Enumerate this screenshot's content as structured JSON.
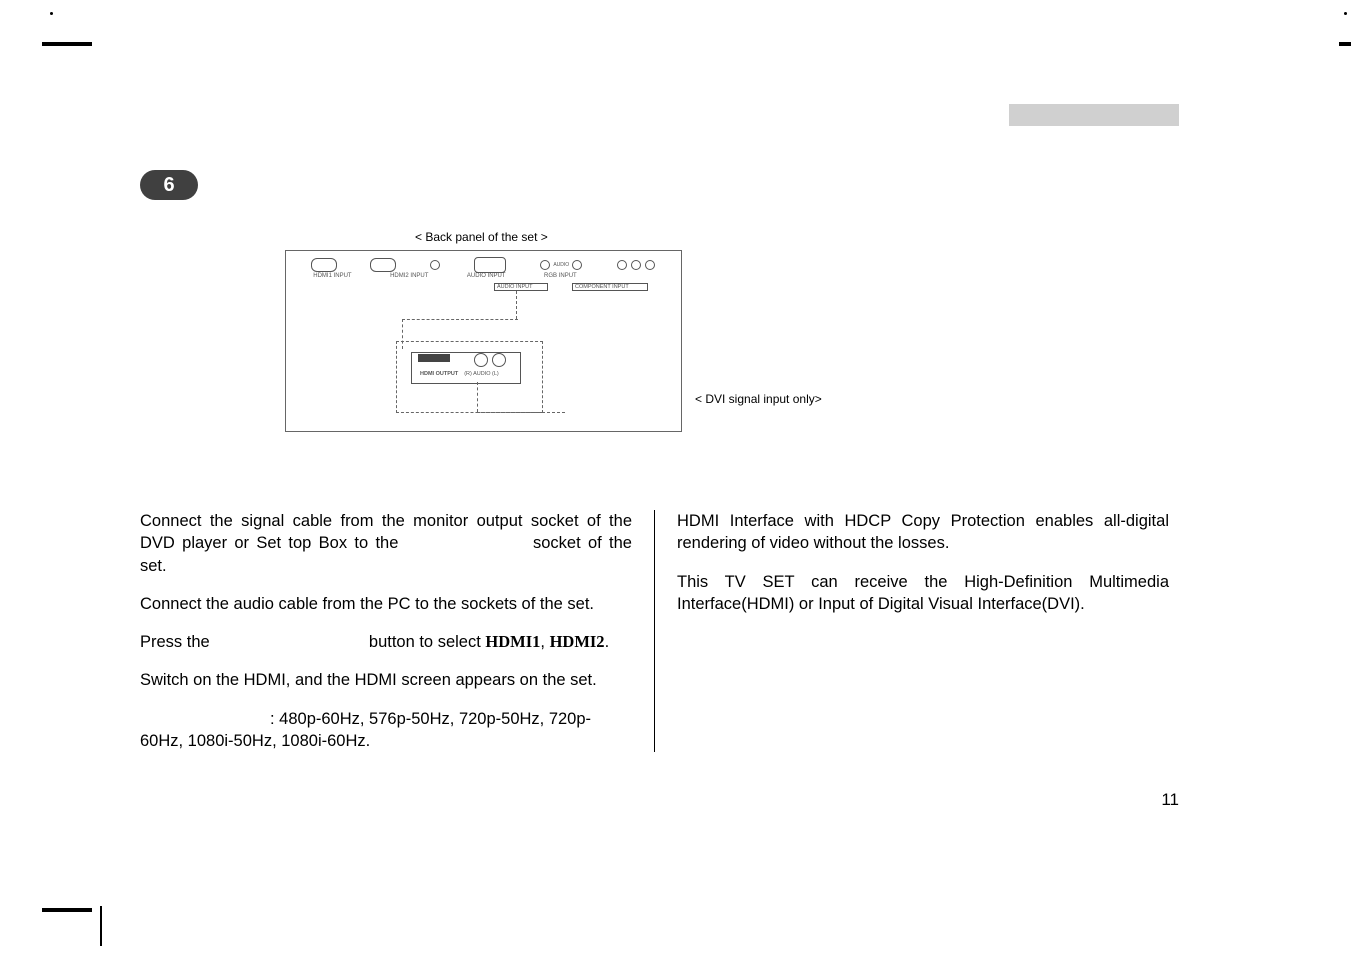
{
  "page": {
    "number": "11",
    "step_badge": "6"
  },
  "diagram": {
    "back_caption": "< Back panel of the set >",
    "dvi_note": "< DVI signal input only>",
    "port_labels": {
      "hdmi1": "HDMI1 INPUT",
      "hdmi2": "HDMI2 INPUT",
      "audio": "AUDIO INPUT",
      "rgb": "RGB INPUT",
      "audio_grp": "AUDIO INPUT",
      "component": "COMPONENT INPUT"
    },
    "module": {
      "hdmi_out": "HDMI OUTPUT",
      "r_audio_l": "(R) AUDIO (L)"
    }
  },
  "left_column": {
    "p1a": "Connect the signal cable from the monitor output socket of the DVD player or Set top Box to the ",
    "p1b": "socket of the set.",
    "p2": "Connect the audio cable from the PC to the sockets of the set.",
    "p3a": "Press  the  ",
    "p3b": "button  to  select  ",
    "hdmi1": "HDMI1",
    "comma": ", ",
    "hdmi2": "HDMI2",
    "period": ".",
    "p4": "Switch on the HDMI, and the HDMI screen appears on the set.",
    "p5": ": 480p-60Hz, 576p-50Hz, 720p-50Hz, 720p-60Hz, 1080i-50Hz, 1080i-60Hz."
  },
  "right_column": {
    "p1": "HDMI Interface with HDCP Copy Protection enables all-digital rendering of video without the losses.",
    "p2": "This TV SET can receive the High-Definition Multimedia Interface(HDMI) or Input of Digital Visual Interface(DVI)."
  }
}
